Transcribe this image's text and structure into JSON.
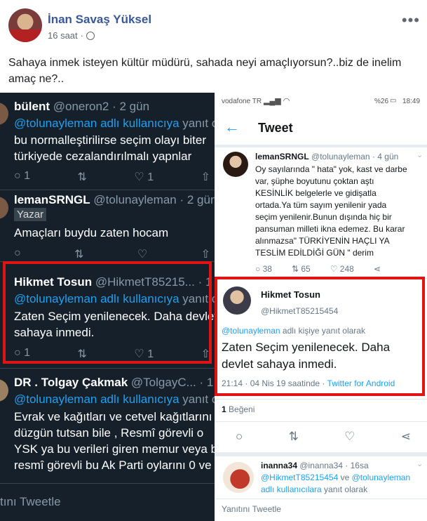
{
  "post": {
    "author": "İnan Savaş Yüksel",
    "time": "16 saat",
    "separator": "·",
    "text": "Sahaya inmek isteyen kültür müdürü, sahada neyi amaçlıyorsun?..biz de inelim amaç ne?.."
  },
  "left": {
    "t1": {
      "name": "bülent",
      "handle": "@oneron2 · 2 gün",
      "mention": "@tolunayleman adlı kullanıcıya",
      "suffix": " yanıt o",
      "line1": "bu normalleştirilirse seçim olayı biter",
      "line2": "türkiyede    cezalandırılmalı yapnlar",
      "reply": "1",
      "like": "1"
    },
    "t2": {
      "name": "lemanSRNGL",
      "handle": "@tolunayleman · 2 gün",
      "badge": "Yazar",
      "text": "Amaçları buydu zaten hocam"
    },
    "t3": {
      "name": "Hikmet Tosun",
      "handle": "@HikmetT85215... · 1",
      "mention": "@tolunayleman adlı kullanıcıya",
      "suffix": " yanıt o",
      "line1": "Zaten Seçim yenilenecek. Daha devlet",
      "line2": "sahaya inmedi.",
      "reply": "1",
      "like": "1"
    },
    "t4": {
      "name": "DR . Tolgay Çakmak",
      "handle": "@TolgayC... · 1",
      "mention": "@tolunayleman adlı kullanıcıya",
      "suffix": " yanıt o",
      "line1": "Evrak ve kağıtları ve cetvel kağıtlarını",
      "line2": "düzgün tutsan bile ,      Resmî görevli o",
      "line3": "YSK ya bu verileri giren memur veya b",
      "line4": "resmî görevli bu Ak Parti oylarını 0 ve"
    },
    "reply_placeholder": "tını Tweetle"
  },
  "right": {
    "carrier": "vodafone TR",
    "battery": "%26",
    "clock": "18:49",
    "header": "Tweet",
    "t1": {
      "name": "lemanSRNGL",
      "handle": "@tolunayleman · 4 gün",
      "lines": [
        "Oy sayılarında \" hata\" yok, kast ve darbe",
        "var, şüphe boyutunu çoktan aştı",
        "KESİNLİK  belgelerle ve gidişatla",
        "ortada.Ya tüm sayım yenilenir yada",
        "seçim yenilenir.Bunun dışında hiç bir",
        "pansuman milleti ikna edemez. Bu karar",
        "alınmazsa\" TÜRKİYENİN HAÇLI YA",
        "TESLİM EDİLDİĞİ GÜN \" derim"
      ],
      "replies": "38",
      "retweets": "65",
      "likes": "248"
    },
    "main": {
      "name": "Hikmet Tosun",
      "handle": "@HikmetT85215454",
      "mention": "@tolunayleman",
      "mention_suffix": " adlı kişiye yanıt olarak",
      "line1": "Zaten Seçim yenilenecek. Daha",
      "line2": "devlet sahaya inmedi.",
      "time": "21:14 · 04 Nis 19 saatinde · ",
      "source": "Twitter for Android"
    },
    "likes_count": "1",
    "likes_label": " Beğeni",
    "t3": {
      "name": "inanna34",
      "handle": "@inanna34 · 16sa",
      "mention1": "@HikmetT85215454",
      "mid": " ve ",
      "mention2": "@tolunayleman",
      "line2": "adlı kullanıcılara",
      "line2_suffix": " yanıt olarak"
    },
    "reply_placeholder": "Yanıtını Tweetle"
  },
  "colors": {
    "fb_blue": "#385898",
    "tw_blue": "#1da1f2",
    "highlight": "#e01414",
    "dark_bg": "#15202b"
  }
}
